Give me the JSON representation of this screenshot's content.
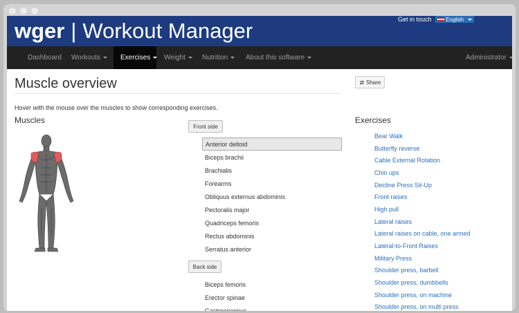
{
  "header": {
    "logo": "wger",
    "separator": "|",
    "title": "Workout Manager",
    "get_in_touch": "Get in touch",
    "language": "English"
  },
  "nav": {
    "items": [
      {
        "label": "Dashboard",
        "dropdown": false,
        "active": false
      },
      {
        "label": "Workouts",
        "dropdown": true,
        "active": false
      },
      {
        "label": "Exercises",
        "dropdown": true,
        "active": true
      },
      {
        "label": "Weight",
        "dropdown": true,
        "active": false
      },
      {
        "label": "Nutrition",
        "dropdown": true,
        "active": false
      },
      {
        "label": "About this software",
        "dropdown": true,
        "active": false
      }
    ],
    "user": "Administrator"
  },
  "page": {
    "title": "Muscle overview",
    "share_label": "Share",
    "hint": "Hover with the mouse over the muscles to show corresponding exercises.",
    "muscles_heading": "Muscles",
    "exercises_heading": "Exercises"
  },
  "front": {
    "button": "Front side",
    "muscles": [
      "Anterior deltoid",
      "Biceps brachii",
      "Brachialis",
      "Forearms",
      "Obliquus externus abdominis",
      "Pectoralis major",
      "Quadriceps femoris",
      "Rectus abdominis",
      "Serratus anterior"
    ],
    "selected": "Anterior deltoid"
  },
  "back": {
    "button": "Back side",
    "muscles": [
      "Biceps femoris",
      "Erector spinae",
      "Gastrocnemius"
    ]
  },
  "exercises": [
    "Bear Walk",
    "Butterfly reverse",
    "Cable External Rotation",
    "Chin ups",
    "Decline Press Sit-Up",
    "Front raises",
    "High pull",
    "Lateral raises",
    "Lateral raises on cable, one armed",
    "Lateral-to-Front Raises",
    "Military Press",
    "Shoulder press, barbell",
    "Shoulder press, dumbbells",
    "Shoulder press, on machine",
    "Shoulder press, on multi press"
  ],
  "colors": {
    "header_bg": "#1e3b80",
    "nav_bg": "#222222",
    "link": "#2a6fba",
    "highlight_muscle": "#d9534f"
  }
}
